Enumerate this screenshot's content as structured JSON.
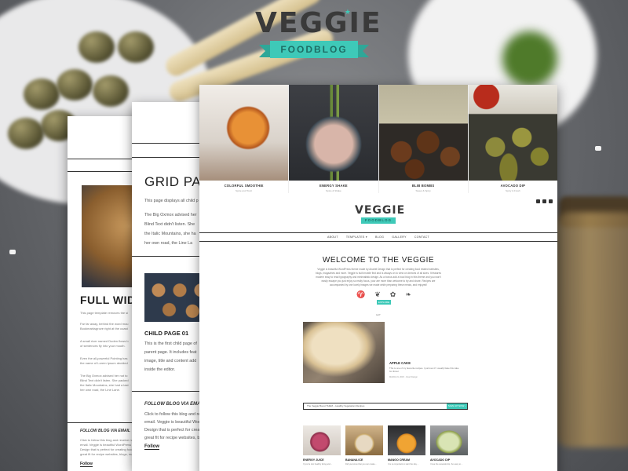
{
  "logo": {
    "word": "VEGGIE",
    "ribbon": "FOODBLOG",
    "star": "★"
  },
  "colors": {
    "accent": "#3ec9b8",
    "dark": "#222222",
    "background": "#5b5d60"
  },
  "back_page": {
    "title": "FULL WIDTH",
    "paragraphs": [
      "This page template removes the si",
      "Far far away, behind the word mou",
      "Bookmarksgrove right at the coast",
      "A small river named Duden flows b",
      "of sentences fly into your mouth.",
      "Even the all-powerful Pointing has",
      "the name of Lorem Ipsum decided",
      "The Big Oxmox advised her not to",
      "Blind Text didn't listen. She packed",
      "the Italic Mountains, she had a last",
      "her own road, the Line Lane."
    ],
    "follow_heading": "FOLLOW BLOG VIA EMAIL",
    "follow_text": [
      "Click to follow this blog and receive noti",
      "email. Veggie is beautiful WordPress th",
      "Design that is perfect for creating food",
      "great fit for recipe websites, blogs, mag"
    ],
    "follow_button": "Follow"
  },
  "mid_page": {
    "title": "GRID PAGE",
    "lines": [
      "This page displays all child p",
      "The Big Oxmox advised her",
      "Blind Text didn't listen. She",
      "the Italic Mountains, she ha",
      "her own road, the Line La"
    ],
    "child_title": "CHILD PAGE 01",
    "child_lines": [
      "This is the first child page of",
      "parent page. It includes feat",
      "image, title and content add",
      "inside the editor."
    ],
    "follow_heading": "FOLLOW BLOG VIA EMAIL",
    "follow_lines": [
      "Click to follow this blog and rece",
      "email. Veggie is beautiful Word",
      "Design that is perfect for creati",
      "great fit for recipe websites, bl"
    ],
    "follow_button": "Follow"
  },
  "front_page": {
    "slides": [
      {
        "title": "COLORFUL SMOOTHIE",
        "sub": "Spice and Tonic"
      },
      {
        "title": "ENERGY SHAKE",
        "sub": "Spice & Shake"
      },
      {
        "title": "BLIB BOMBS",
        "sub": "Sweet & Spicy"
      },
      {
        "title": "AVOCADO DIP",
        "sub": "Spicy & Fresh"
      }
    ],
    "mini_logo": {
      "word": "VEGGIE",
      "ribbon": "FOODBLOG"
    },
    "nav": [
      "ABOUT",
      "TEMPLATES ▾",
      "BLOG",
      "GALLERY",
      "CONTACT"
    ],
    "welcome": "WELCOME TO THE VEGGIE",
    "intro": "Veggie is beautiful WordPress theme made by Anariel Design that is perfect for creating food related websites, blogs, magazines and more. Veggie is built mobile first and is always on to view on devices of all sizes. It features modern easy to read typography and minimalistic design. As a bonus add a food blog in this theme and you won't easily escape you just enjoy so really focus, your are more than welcome to try and share. Recipes are accompanied by one lovely images we made while preparing these meals, and enjoyed!",
    "icons": [
      "leaf-icon",
      "pepper-icon",
      "herb-icon",
      "sprout-icon"
    ],
    "icon_glyphs": [
      "♈",
      "❦",
      "✿",
      "❧"
    ],
    "explore": "EXPLORE",
    "eat": "EAT",
    "feature": {
      "title": "APPLE CAKE",
      "text": "This is one of my favourite recipes. I just love it! I usually bake this cake for dinner.",
      "date": "MARCH 9, 2015 · Food Design"
    },
    "subscribe": {
      "placeholder": "The Veggie Boost THEM – Healthy Vegetarian Recipes",
      "button": "SIGN UP NOW ›"
    },
    "thumbs": [
      {
        "title": "ENERGY JUICE",
        "text": "If you're into healthy living and…"
      },
      {
        "title": "BANANA ICE",
        "text": "Did you know that you can make…"
      },
      {
        "title": "MANGO CREAM",
        "text": "It is so important to start the day…"
      },
      {
        "title": "AVOCADO DIP",
        "text": "I love the avocado dip. So easy to…"
      }
    ]
  }
}
